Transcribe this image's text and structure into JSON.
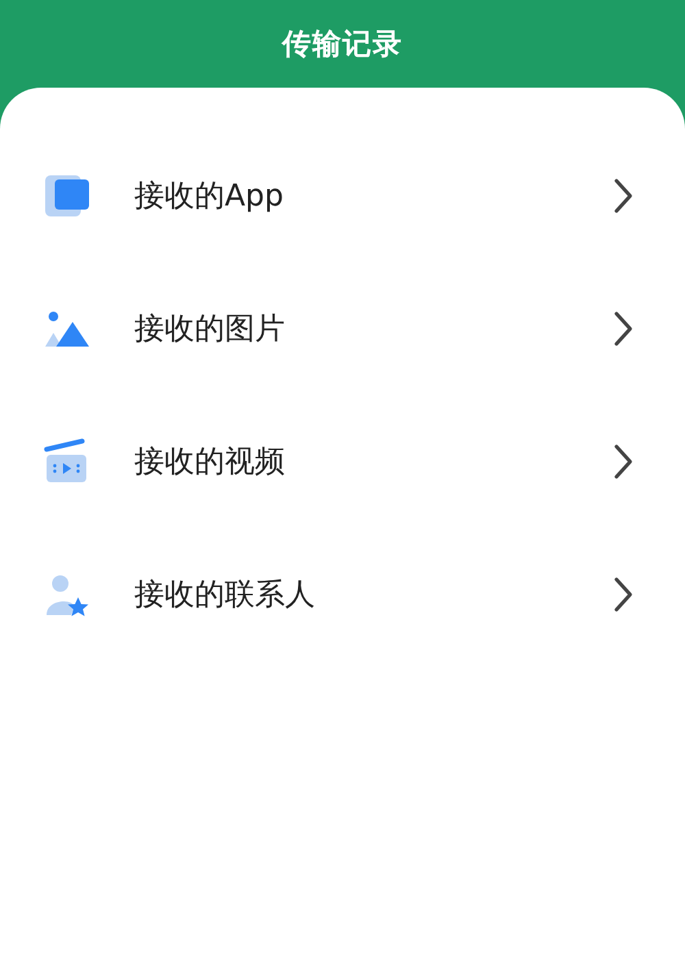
{
  "header": {
    "title": "传输记录"
  },
  "items": [
    {
      "kind": "app",
      "label": "接收的App"
    },
    {
      "kind": "image",
      "label": "接收的图片"
    },
    {
      "kind": "video",
      "label": "接收的视频"
    },
    {
      "kind": "contact",
      "label": "接收的联系人"
    }
  ]
}
